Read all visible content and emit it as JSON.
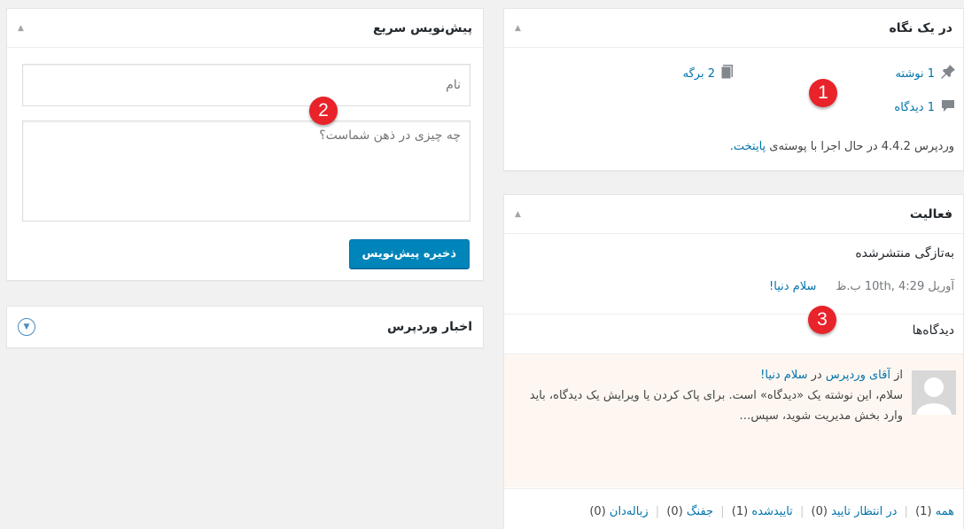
{
  "glance": {
    "title": "در یک نگاه",
    "posts": "1 نوشته",
    "pages": "2 برگه",
    "comments": "1 دیدگاه",
    "version_text": "وردپرس 4.4.2 در حال اجرا با پوسته‌ی",
    "theme_link": "پایتخت."
  },
  "activity": {
    "title": "فعالیت",
    "recently_published": "به‌تازگی منتشرشده",
    "post_date": "آوریل 10th, 4:29 ب.ظ",
    "post_title": "سلام دنیا!",
    "comments_heading": "دیدگاه‌ها",
    "comment_from": "از",
    "comment_author": "آقای وردپرس",
    "comment_on": "در",
    "comment_post": "سلام دنیا!",
    "comment_excerpt": "سلام، این نوشته یک «دیدگاه» است. برای پاک کردن یا ویرایش یک دیدگاه، باید وارد بخش مدیریت شوید، سپس…",
    "filters": [
      {
        "label": "همه",
        "count": "(1)"
      },
      {
        "label": "در انتظار تایید",
        "count": "(0)"
      },
      {
        "label": "تاییدشده",
        "count": "(1)"
      },
      {
        "label": "جفنگ",
        "count": "(0)"
      },
      {
        "label": "زباله‌دان",
        "count": "(0)"
      }
    ]
  },
  "draft": {
    "title": "پیش‌نویس سریع",
    "title_placeholder": "نام",
    "content_placeholder": "چه چیزی در ذهن شماست؟",
    "save_label": "ذخیره پیش‌نویس"
  },
  "news": {
    "title": "اخبار وردپرس"
  },
  "markers": {
    "m1": "1",
    "m2": "2",
    "m3": "3"
  },
  "colors": {
    "link": "#0073aa",
    "primary_button": "#0085ba",
    "marker": "#e8232a"
  }
}
